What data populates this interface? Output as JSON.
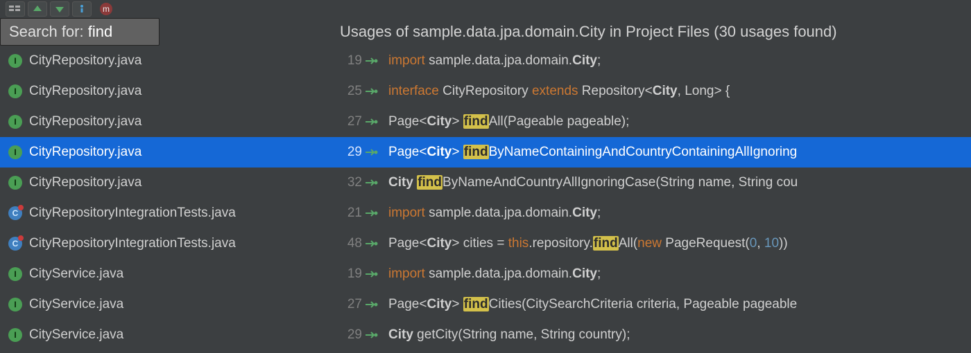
{
  "search": {
    "prefix": "Search for:",
    "query": "find"
  },
  "m_badge": "m",
  "title": "Usages of sample.data.jpa.domain.City in Project Files (30 usages found)",
  "rows": [
    {
      "icon": "I",
      "file": "CityRepository.java",
      "line": 19,
      "selected": false,
      "tokens": [
        [
          "kw",
          "import"
        ],
        [
          "",
          ". sample.data.jpa.domain."
        ],
        [
          "b",
          "City"
        ],
        [
          ";",
          ";"
        ]
      ],
      "plain": "import sample.data.jpa.domain.City;"
    },
    {
      "icon": "I",
      "file": "CityRepository.java",
      "line": 25
    },
    {
      "icon": "I",
      "file": "CityRepository.java",
      "line": 27
    },
    {
      "icon": "I",
      "file": "CityRepository.java",
      "line": 29,
      "selected": true
    },
    {
      "icon": "I",
      "file": "CityRepository.java",
      "line": 32
    },
    {
      "icon": "C",
      "file": "CityRepositoryIntegrationTests.java",
      "line": 21
    },
    {
      "icon": "C",
      "file": "CityRepositoryIntegrationTests.java",
      "line": 48
    },
    {
      "icon": "I",
      "file": "CityService.java",
      "line": 19
    },
    {
      "icon": "I",
      "file": "CityService.java",
      "line": 27
    },
    {
      "icon": "I",
      "file": "CityService.java",
      "line": 29
    }
  ],
  "code_lines": {
    "0": "<span class='kw'>import</span> sample.data.jpa.domain.<span class='b'>City</span>;",
    "1": "<span class='kw'>interface</span> CityRepository <span class='kw'>extends</span> Repository&lt;<span class='b'>City</span>, Long&gt; {",
    "2": "Page&lt;<span class='b'>City</span>&gt; <span class='hl'>find</span>All(Pageable pageable);",
    "3": "Page&lt;<span class='b'>City</span>&gt; <span class='hl'>find</span>ByNameContainingAndCountryContainingAllIgnoring",
    "4": "<span class='b'>City</span> <span class='hl'>find</span>ByNameAndCountryAllIgnoringCase(String name, String cou",
    "5": "<span class='kw'>import</span> sample.data.jpa.domain.<span class='b'>City</span>;",
    "6": "Page&lt;<span class='b'>City</span>&gt; cities = <span class='kw'>this</span>.repository.<span class='hl'>find</span>All(<span class='kw'>new</span> PageRequest(<span class='num'>0</span>, <span class='num'>10</span>))",
    "7": "<span class='kw'>import</span> sample.data.jpa.domain.<span class='b'>City</span>;",
    "8": "Page&lt;<span class='b'>City</span>&gt; <span class='hl'>find</span>Cities(CitySearchCriteria criteria, Pageable pageable",
    "9": "<span class='b'>City</span> getCity(String name, String country);"
  }
}
